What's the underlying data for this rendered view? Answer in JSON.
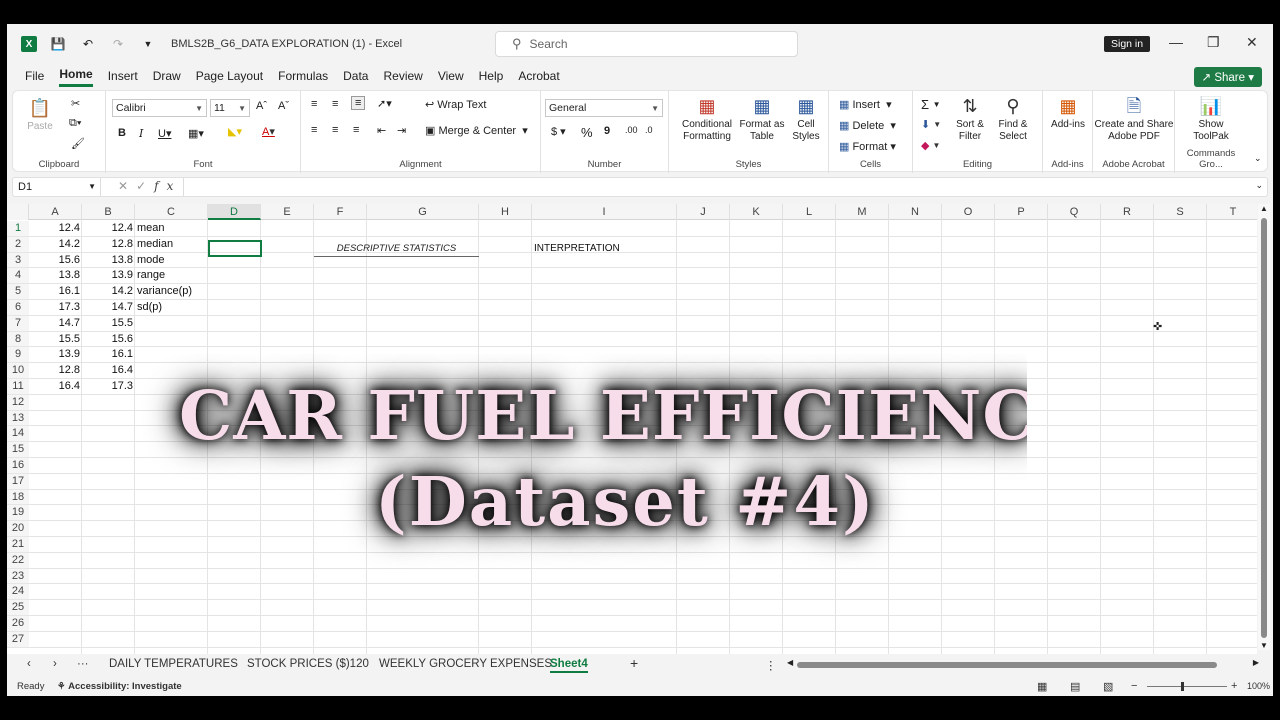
{
  "titlebar": {
    "doc_title": "BMLS2B_G6_DATA EXPLORATION (1)  -  Excel",
    "search_placeholder": "Search",
    "signin_label": "Sign in"
  },
  "menu_tabs": [
    "File",
    "Home",
    "Insert",
    "Draw",
    "Page Layout",
    "Formulas",
    "Data",
    "Review",
    "View",
    "Help",
    "Acrobat"
  ],
  "share_label": "Share",
  "ribbon": {
    "clipboard": {
      "label": "Clipboard",
      "paste": "Paste"
    },
    "font": {
      "label": "Font",
      "name": "Calibri",
      "size": "11"
    },
    "alignment": {
      "label": "Alignment",
      "wrap": "Wrap Text",
      "merge": "Merge & Center"
    },
    "number": {
      "label": "Number",
      "format": "General"
    },
    "styles": {
      "label": "Styles",
      "conditional": "Conditional\nFormatting",
      "format_table": "Format as\nTable",
      "cell_styles": "Cell\nStyles"
    },
    "cells": {
      "label": "Cells",
      "insert": "Insert",
      "delete": "Delete",
      "format": "Format"
    },
    "editing": {
      "label": "Editing",
      "sort": "Sort &\nFilter",
      "find": "Find &\nSelect"
    },
    "addins": {
      "label": "Add-ins",
      "btn": "Add-ins"
    },
    "acrobat": {
      "label": "Adobe Acrobat",
      "btn": "Create and Share\nAdobe PDF"
    },
    "commands": {
      "label": "Commands Gro...",
      "btn": "Show\nToolPak"
    }
  },
  "formula_bar": {
    "name_box": "D1",
    "fx": "fx",
    "value": ""
  },
  "columns": [
    "A",
    "B",
    "C",
    "D",
    "E",
    "F",
    "G",
    "H",
    "I",
    "J",
    "K",
    "L",
    "M",
    "N",
    "O",
    "P",
    "Q",
    "R",
    "S",
    "T"
  ],
  "rows": [
    "1",
    "2",
    "3",
    "4",
    "5",
    "6",
    "7",
    "8",
    "9",
    "10",
    "11",
    "12",
    "13",
    "14",
    "15",
    "16",
    "17",
    "18",
    "19",
    "20",
    "21",
    "22",
    "23",
    "24",
    "25",
    "26",
    "27"
  ],
  "sheet": {
    "col_a": [
      "12.4",
      "14.2",
      "15.6",
      "13.8",
      "16.1",
      "17.3",
      "14.7",
      "15.5",
      "13.9",
      "12.8",
      "16.4"
    ],
    "col_b": [
      "12.4",
      "12.8",
      "13.8",
      "13.9",
      "14.2",
      "14.7",
      "15.5",
      "15.6",
      "16.1",
      "16.4",
      "17.3"
    ],
    "col_c": [
      "mean",
      "median",
      "mode",
      "range",
      "variance(p)",
      "sd(p)"
    ],
    "descriptive": "DESCRIPTIVE STATISTICS",
    "interpretation": "INTERPRETATION"
  },
  "overlay": {
    "line1": "CAR FUEL EFFICIENC",
    "line2": "(Dataset #4)"
  },
  "sheet_tabs": [
    "DAILY TEMPERATURES",
    "STOCK PRICES ($)120",
    "WEEKLY GROCERY EXPENSES",
    "Sheet4"
  ],
  "status": {
    "ready": "Ready",
    "accessibility": "Accessibility: Investigate",
    "zoom": "100%"
  }
}
